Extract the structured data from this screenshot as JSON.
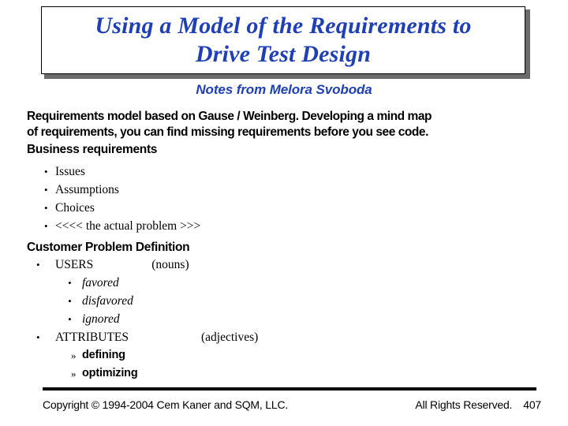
{
  "slide": {
    "title_line1": "Using a Model of the Requirements to",
    "title_line2": "Drive Test Design",
    "subtitle": "Notes from Melora Svoboda",
    "title_color": "#1f3fb5",
    "body_color": "#000000",
    "background": "#ffffff"
  },
  "body": {
    "intro_line1": "Requirements model based on Gause / Weinberg. Developing a mind map",
    "intro_line2": "of requirements, you can find missing requirements before you see code.",
    "heading_business": "Business requirements",
    "business_items": [
      "Issues",
      "Assumptions",
      "Choices",
      "<<<< the actual problem >>>"
    ],
    "heading_customer": "Customer Problem Definition",
    "users_label": "USERS",
    "users_note": "(nouns)",
    "users_items": [
      "favored",
      "disfavored",
      "ignored"
    ],
    "attributes_label": "ATTRIBUTES",
    "attributes_note": "(adjectives)",
    "attributes_items": [
      "defining",
      "optimizing"
    ]
  },
  "footer": {
    "copyright": "Copyright © 1994-2004 Cem Kaner and SQM, LLC.",
    "rights": "All Rights Reserved.",
    "page_number": "407"
  }
}
